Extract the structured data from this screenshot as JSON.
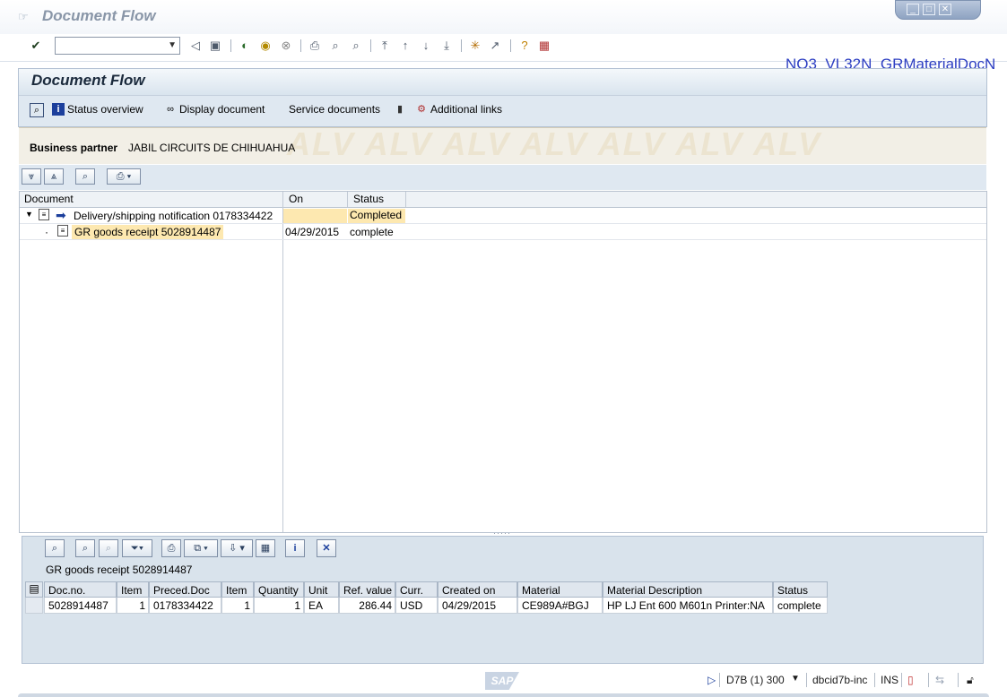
{
  "window": {
    "title": "Document Flow",
    "controls": {
      "minimize": "_",
      "maximize": "□",
      "close": "✕"
    }
  },
  "toolbar": {
    "command_field_value": "",
    "icons": [
      "enter-icon",
      "back-icon",
      "save-icon",
      "back-green-icon",
      "exit-icon",
      "cancel-icon",
      "print-icon",
      "find-icon",
      "find-next-icon",
      "first-page-icon",
      "previous-page-icon",
      "next-page-icon",
      "last-page-icon",
      "create-session-icon",
      "shortcut-icon",
      "help-icon",
      "layout-icon"
    ]
  },
  "program_name": "NO3_VL32N_GRMaterialDocN",
  "panel": {
    "title": "Document Flow",
    "buttons": {
      "status_overview": "Status overview",
      "display_document": "Display document",
      "service_documents": "Service documents",
      "additional_links": "Additional links"
    }
  },
  "business_partner": {
    "label": "Business partner",
    "value": "JABIL CIRCUITS DE CHIHUAHUA",
    "watermark": "ALV ALV ALV ALV ALV ALV ALV"
  },
  "tree": {
    "columns": {
      "document": "Document",
      "on": "On",
      "status": "Status"
    },
    "rows": [
      {
        "document": "Delivery/shipping notification 0178334422",
        "on": "",
        "status": "Completed"
      },
      {
        "document": "GR goods receipt 5028914487",
        "on": "04/29/2015",
        "status": "complete"
      }
    ]
  },
  "bottom": {
    "title": "GR goods receipt 5028914487",
    "columns": {
      "doc_no": "Doc.no.",
      "item": "Item",
      "preced_doc": "Preced.Doc",
      "item2": "Item",
      "quantity": "Quantity",
      "unit": "Unit",
      "ref_value": "Ref. value",
      "curr": "Curr.",
      "created_on": "Created on",
      "material": "Material",
      "material_description": "Material Description",
      "status": "Status"
    },
    "rows": [
      {
        "doc_no": "5028914487",
        "item": "1",
        "preced_doc": "0178334422",
        "item2": "1",
        "quantity": "1",
        "unit": "EA",
        "ref_value": "286.44",
        "curr": "USD",
        "created_on": "04/29/2015",
        "material": "CE989A#BGJ",
        "material_description": "HP LJ Ent 600 M601n Printer:NA",
        "status": "complete"
      }
    ]
  },
  "statusbar": {
    "logo": "SAP",
    "system": "D7B (1) 300",
    "server": "dbcid7b-inc",
    "mode": "INS"
  },
  "colors": {
    "highlight": "#fde8b0",
    "panel_bg": "#dfe8f1",
    "program_name": "#2c3ec2"
  }
}
